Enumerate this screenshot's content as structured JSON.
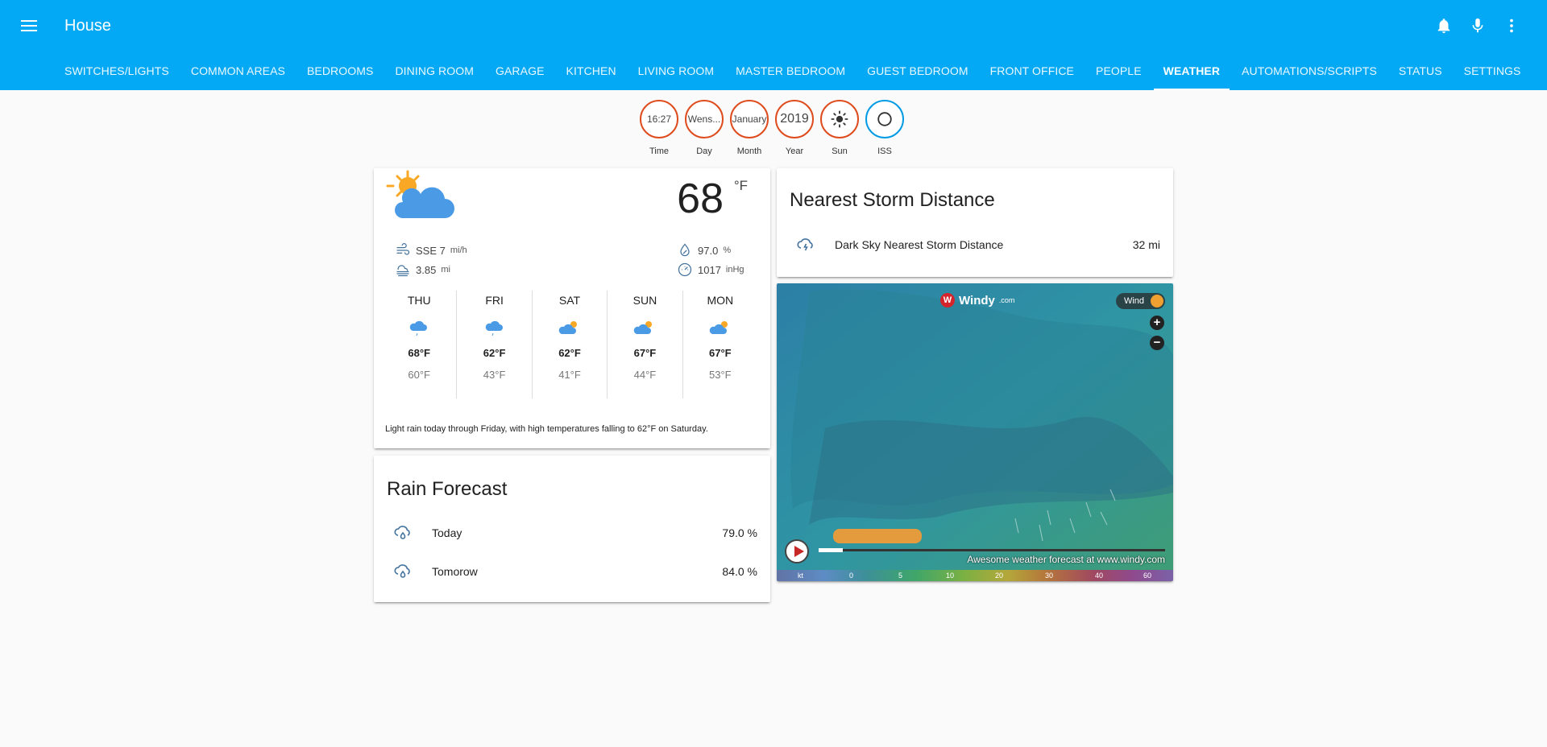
{
  "app": {
    "title": "House"
  },
  "tabs": [
    "SWITCHES/LIGHTS",
    "COMMON AREAS",
    "BEDROOMS",
    "DINING ROOM",
    "GARAGE",
    "KITCHEN",
    "LIVING ROOM",
    "MASTER BEDROOM",
    "GUEST BEDROOM",
    "FRONT OFFICE",
    "PEOPLE",
    "WEATHER",
    "AUTOMATIONS/SCRIPTS",
    "STATUS",
    "SETTINGS"
  ],
  "active_tab": "WEATHER",
  "badges": [
    {
      "value": "16:27",
      "label": "Time"
    },
    {
      "value": "Wens...",
      "label": "Day"
    },
    {
      "value": "January",
      "label": "Month"
    },
    {
      "value": "2019",
      "label": "Year"
    },
    {
      "value": "",
      "label": "Sun",
      "icon": "sun-icon"
    },
    {
      "value": "",
      "label": "ISS",
      "icon": "circle-outline-icon"
    }
  ],
  "weather": {
    "temperature": "68",
    "unit": "°F",
    "wind": "SSE 7",
    "wind_unit": "mi/h",
    "visibility": "3.85",
    "visibility_unit": "mi",
    "humidity": "97.0",
    "humidity_unit": "%",
    "pressure": "1017",
    "pressure_unit": "inHg",
    "forecast": [
      {
        "day": "THU",
        "high": "68°F",
        "low": "60°F",
        "icon": "rainy-icon"
      },
      {
        "day": "FRI",
        "high": "62°F",
        "low": "43°F",
        "icon": "rainy-icon"
      },
      {
        "day": "SAT",
        "high": "62°F",
        "low": "41°F",
        "icon": "partly-cloudy-icon"
      },
      {
        "day": "SUN",
        "high": "67°F",
        "low": "44°F",
        "icon": "partly-cloudy-icon"
      },
      {
        "day": "MON",
        "high": "67°F",
        "low": "53°F",
        "icon": "partly-cloudy-icon"
      }
    ],
    "summary": "Light rain today through Friday, with high temperatures falling to 62°F on Saturday."
  },
  "rain": {
    "title": "Rain Forecast",
    "rows": [
      {
        "name": "Today",
        "state": "79.0 %"
      },
      {
        "name": "Tomorow",
        "state": "84.0 %"
      }
    ]
  },
  "storm": {
    "title": "Nearest Storm Distance",
    "row": {
      "name": "Dark Sky Nearest Storm Distance",
      "state": "32 mi"
    }
  },
  "windy": {
    "logo": "Windy",
    "logo_suffix": ".com",
    "layer": "Wind",
    "credit": "Awesome weather forecast at www.windy.com",
    "scale": [
      "kt",
      "0",
      "5",
      "10",
      "20",
      "30",
      "40",
      "60"
    ]
  },
  "colors": {
    "primary": "#03a9f4",
    "badge_border": "#df4c1e",
    "icon": "#44739e"
  }
}
